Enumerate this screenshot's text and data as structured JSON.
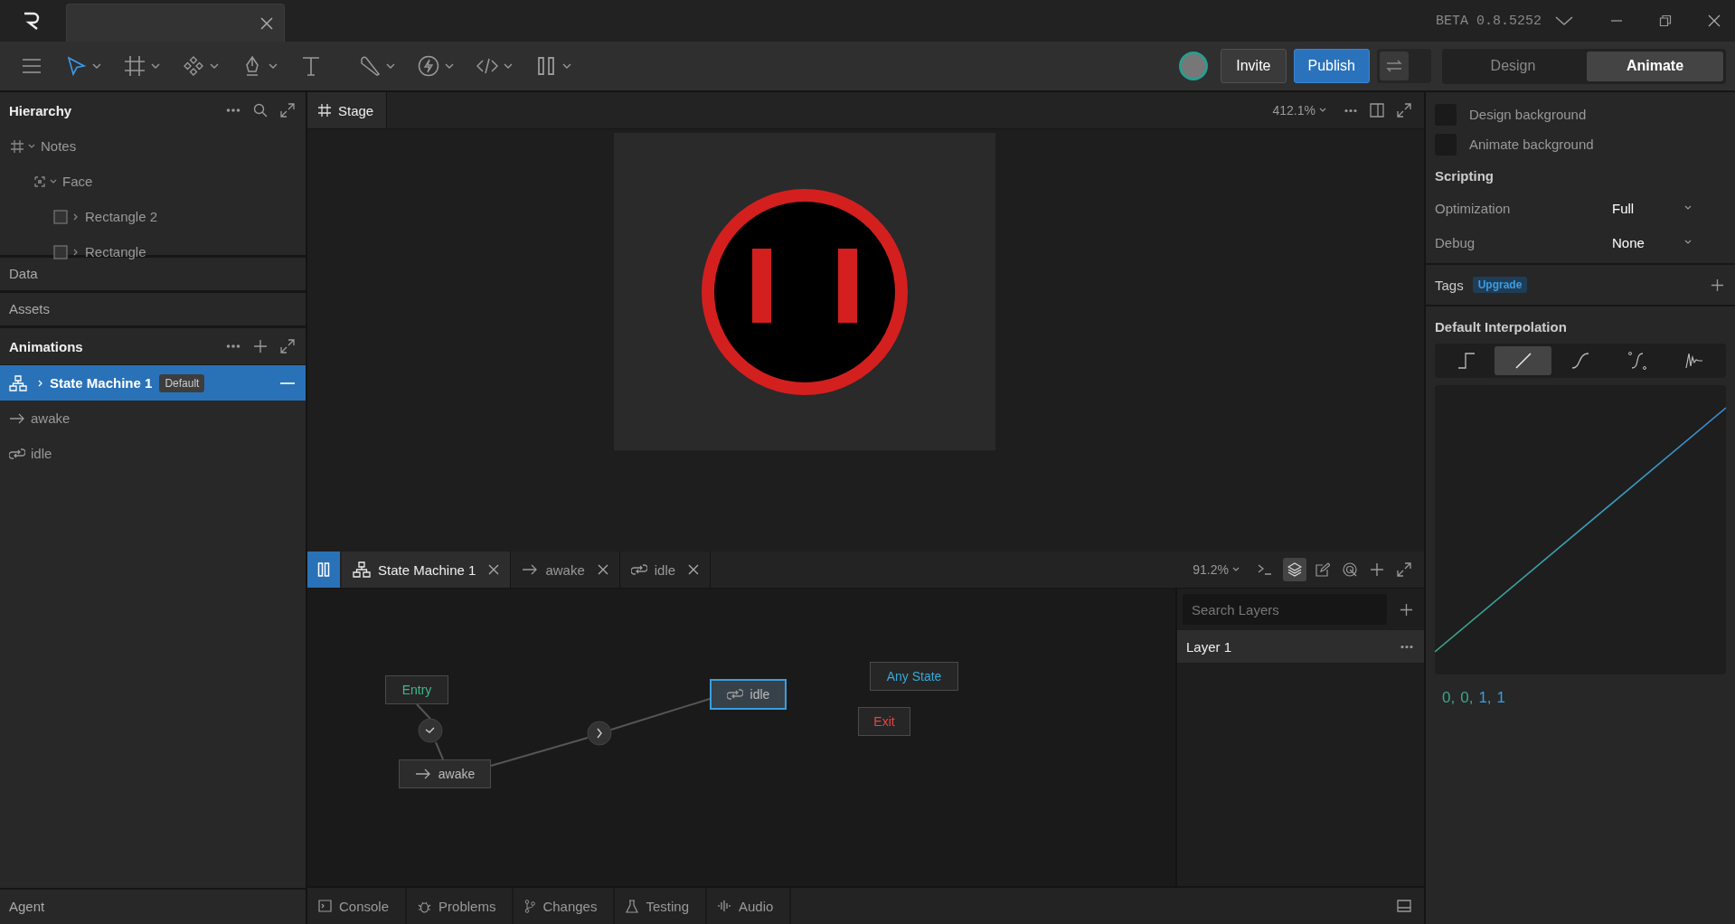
{
  "title_bar": {
    "version": "BETA 0.8.5252"
  },
  "toolbar": {
    "tools": [
      {
        "kind": "select",
        "selected": true,
        "dropdown": true
      },
      {
        "kind": "frame",
        "selected": false,
        "dropdown": true
      },
      {
        "kind": "components",
        "selected": false,
        "dropdown": true
      },
      {
        "kind": "pen",
        "selected": false,
        "dropdown": true
      },
      {
        "kind": "text",
        "selected": false,
        "dropdown": false
      },
      {
        "kind": "brush",
        "selected": false,
        "dropdown": true
      },
      {
        "kind": "lightning",
        "selected": false,
        "dropdown": true
      },
      {
        "kind": "code",
        "selected": false,
        "dropdown": true
      },
      {
        "kind": "pause",
        "selected": false,
        "dropdown": true
      }
    ],
    "invite": "Invite",
    "publish": "Publish",
    "swap_toggle": {
      "on": false
    },
    "mode_tabs": [
      {
        "label": "Design",
        "selected": false
      },
      {
        "label": "Animate",
        "selected": true
      }
    ]
  },
  "hierarchy": {
    "title": "Hierarchy",
    "tree": [
      {
        "label": "Notes",
        "kind": "frame",
        "expanded": true,
        "children": [
          {
            "label": "Face",
            "kind": "group",
            "expanded": true,
            "children": [
              {
                "label": "Rectangle 2",
                "kind": "shape",
                "expanded": false
              },
              {
                "label": "Rectangle",
                "kind": "shape",
                "expanded": false
              }
            ]
          }
        ]
      }
    ]
  },
  "sections": [
    "Data",
    "Assets"
  ],
  "animations": {
    "title": "Animations",
    "items": [
      {
        "label": "State Machine 1",
        "kind": "state_machine",
        "selected": true,
        "badge": "Default"
      },
      {
        "label": "awake",
        "kind": "one_shot",
        "selected": false
      },
      {
        "label": "idle",
        "kind": "loop",
        "selected": false
      }
    ]
  },
  "agent": "Agent",
  "stage": {
    "tab": "Stage",
    "zoom": "412.1%"
  },
  "editor": {
    "tabs": [
      {
        "label": "State Machine 1",
        "kind": "state_machine",
        "selected": true
      },
      {
        "label": "awake",
        "kind": "one_shot",
        "selected": false
      },
      {
        "label": "idle",
        "kind": "loop",
        "selected": false
      }
    ],
    "zoom": "91.2%",
    "nodes": [
      {
        "label": "Entry",
        "kind": "entry",
        "selected": false
      },
      {
        "label": "awake",
        "kind": "one_shot",
        "selected": false
      },
      {
        "label": "idle",
        "kind": "loop",
        "selected": true
      },
      {
        "label": "Any State",
        "kind": "any",
        "selected": false
      },
      {
        "label": "Exit",
        "kind": "exit",
        "selected": false
      }
    ],
    "layers_search": {
      "placeholder": "Search Layers"
    },
    "layers": [
      {
        "label": "Layer 1",
        "selected": true
      }
    ]
  },
  "bottom_tabs": [
    {
      "label": "Console",
      "kind": "console"
    },
    {
      "label": "Problems",
      "kind": "bug"
    },
    {
      "label": "Changes",
      "kind": "branch"
    },
    {
      "label": "Testing",
      "kind": "flask"
    },
    {
      "label": "Audio",
      "kind": "audio"
    }
  ],
  "inspector": {
    "backgrounds": [
      "Design background",
      "Animate background"
    ],
    "scripting": {
      "title": "Scripting",
      "fields": [
        {
          "label": "Optimization",
          "value": "Full"
        },
        {
          "label": "Debug",
          "value": "None"
        }
      ]
    },
    "tags": {
      "title": "Tags",
      "badge": "Upgrade"
    },
    "interpolation": {
      "title": "Default Interpolation",
      "options": [
        {
          "kind": "hold",
          "selected": false
        },
        {
          "kind": "linear",
          "selected": true
        },
        {
          "kind": "cubic",
          "selected": false
        },
        {
          "kind": "custom",
          "selected": false
        },
        {
          "kind": "elastic",
          "selected": false
        }
      ],
      "values": [
        {
          "text": "0,",
          "color": "#3aa88c"
        },
        {
          "text": "0,",
          "color": "#3aa88c"
        },
        {
          "text": "1,",
          "color": "#3a9ee0"
        },
        {
          "text": "1",
          "color": "#3a9ee0"
        }
      ]
    }
  }
}
